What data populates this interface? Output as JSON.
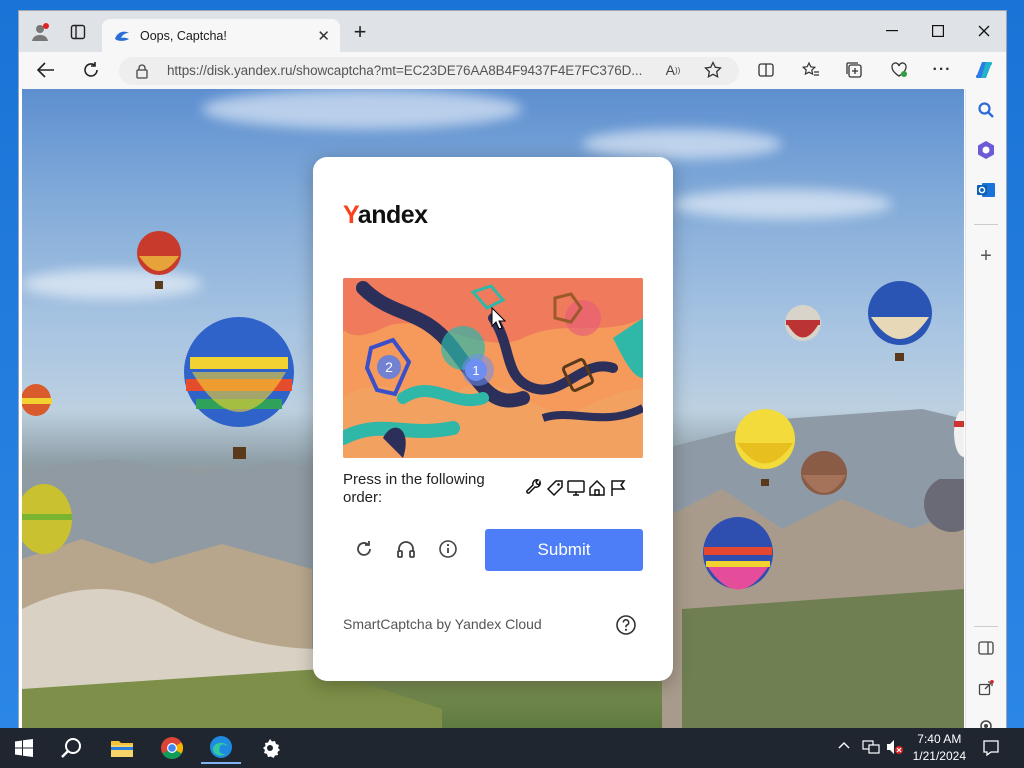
{
  "browser": {
    "tab_title": "Oops, Captcha!",
    "url": "https://disk.yandex.ru/showcaptcha?mt=EC23DE76AA8B4F9437F4E7FC376D..."
  },
  "captcha": {
    "logo_y": "Y",
    "logo_rest": "andex",
    "prompt": "Press in the following order:",
    "order_icons": [
      "wrench-icon",
      "tag-icon",
      "monitor-icon",
      "house-icon",
      "flag-icon"
    ],
    "marker_1": "1",
    "marker_2": "2",
    "submit_label": "Submit",
    "footer": "SmartCaptcha by Yandex Cloud"
  },
  "taskbar": {
    "time": "7:40 AM",
    "date": "1/21/2024"
  },
  "colors": {
    "accent": "#4d7ef7",
    "yandex_red": "#fc3f1d",
    "taskbar": "#1f2630"
  }
}
